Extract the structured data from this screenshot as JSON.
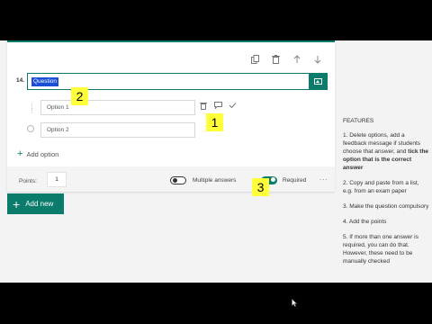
{
  "question": {
    "number": "14.",
    "title": "Question",
    "options": [
      {
        "label": "Option 1"
      },
      {
        "label": "Option 2"
      }
    ],
    "add_option_label": "Add option"
  },
  "toolbar": {
    "icons": [
      "copy-icon",
      "delete-icon",
      "move-up-icon",
      "move-down-icon"
    ]
  },
  "option_actions": [
    "delete-icon",
    "feedback-icon",
    "correct-answer-check-icon"
  ],
  "footer": {
    "points_label": "Points:",
    "points_value": "1",
    "multiple_answers_label": "Multiple answers",
    "multiple_answers_on": false,
    "required_label": "Required",
    "required_on": true,
    "more_label": "..."
  },
  "add_new_label": "Add new",
  "badges": {
    "two": "2",
    "one": "1",
    "three": "3"
  },
  "features": {
    "heading": "FEATURES",
    "item1_pre": "1. Delete options, add a feedback message if students choose that answer, and ",
    "item1_bold": "tick the option that is the correct answer",
    "item2": "2. Copy and paste from a list, e.g. from an exam paper",
    "item3": "3. Make the question compulsory",
    "item4": "4. Add the points",
    "item5": "5. If more than one answer is required, you can do that. However, these need to be manually checked"
  },
  "colors": {
    "accent": "#0b7b6b",
    "highlight": "#ffff3a",
    "selection": "#1a4fd6"
  }
}
